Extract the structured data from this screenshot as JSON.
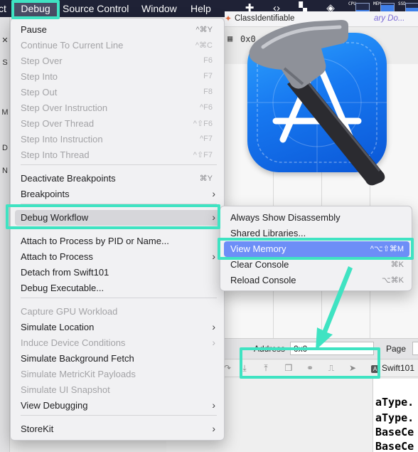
{
  "menubar": {
    "items": [
      {
        "label": "ct"
      },
      {
        "label": "Debug"
      },
      {
        "label": "Source Control"
      },
      {
        "label": "Window"
      },
      {
        "label": "Help"
      }
    ],
    "status_icons": [
      "plus-cross-icon",
      "code-brackets-icon",
      "bookmark-icon",
      "layers-icon"
    ],
    "meters": [
      {
        "label": "CPU",
        "level": 0.35
      },
      {
        "label": "MEM",
        "level": 0.85
      },
      {
        "label": "SSD",
        "level": 0.6
      }
    ]
  },
  "background": {
    "jumpbar_crumb": "ClassIdentifiable",
    "jumpbar_crumb2": "ary Do...",
    "memory_row": "0x0",
    "address_label": "Address",
    "address_value": "0x0",
    "page_label": "Page",
    "debug_target": "Swift101",
    "console_lines": [
      "aType.",
      "aType.",
      "BaseCe",
      "BaseCe"
    ]
  },
  "debug_menu": {
    "items": [
      {
        "label": "Pause",
        "shortcut": "^⌘Y",
        "enabled": true
      },
      {
        "label": "Continue To Current Line",
        "shortcut": "^⌘C",
        "enabled": false
      },
      {
        "label": "Step Over",
        "shortcut": "F6",
        "enabled": false
      },
      {
        "label": "Step Into",
        "shortcut": "F7",
        "enabled": false
      },
      {
        "label": "Step Out",
        "shortcut": "F8",
        "enabled": false
      },
      {
        "label": "Step Over Instruction",
        "shortcut": "^F6",
        "enabled": false
      },
      {
        "label": "Step Over Thread",
        "shortcut": "^⇧F6",
        "enabled": false
      },
      {
        "label": "Step Into Instruction",
        "shortcut": "^F7",
        "enabled": false
      },
      {
        "label": "Step Into Thread",
        "shortcut": "^⇧F7",
        "enabled": false
      },
      {
        "label": "Deactivate Breakpoints",
        "shortcut": "⌘Y",
        "enabled": true
      },
      {
        "label": "Breakpoints",
        "shortcut": "",
        "enabled": true
      },
      {
        "label": "Debug Workflow",
        "shortcut": "",
        "enabled": true
      },
      {
        "label": "Attach to Process by PID or Name...",
        "shortcut": "",
        "enabled": true
      },
      {
        "label": "Attach to Process",
        "shortcut": "",
        "enabled": true
      },
      {
        "label": "Detach from Swift101",
        "shortcut": "",
        "enabled": true
      },
      {
        "label": "Debug Executable...",
        "shortcut": "",
        "enabled": true
      },
      {
        "label": "Capture GPU Workload",
        "shortcut": "",
        "enabled": false
      },
      {
        "label": "Simulate Location",
        "shortcut": "",
        "enabled": true
      },
      {
        "label": "Induce Device Conditions",
        "shortcut": "",
        "enabled": false
      },
      {
        "label": "Simulate Background Fetch",
        "shortcut": "",
        "enabled": true
      },
      {
        "label": "Simulate MetricKit Payloads",
        "shortcut": "",
        "enabled": false
      },
      {
        "label": "Simulate UI Snapshot",
        "shortcut": "",
        "enabled": false
      },
      {
        "label": "View Debugging",
        "shortcut": "",
        "enabled": true
      },
      {
        "label": "StoreKit",
        "shortcut": "",
        "enabled": true
      }
    ]
  },
  "debug_workflow_submenu": {
    "items": [
      {
        "label": "Always Show Disassembly",
        "shortcut": ""
      },
      {
        "label": "Shared Libraries...",
        "shortcut": ""
      },
      {
        "label": "View Memory",
        "shortcut": "^⌥⇧⌘M"
      },
      {
        "label": "Clear Console",
        "shortcut": "⌘K"
      },
      {
        "label": "Reload Console",
        "shortcut": "⌥⌘K"
      }
    ]
  },
  "colors": {
    "menubar_bg": "#1f2236",
    "menu_bg": "#f1f1f3",
    "selection_blue": "#6d8ef7",
    "annotation_teal": "#3fe3c2",
    "xcode_icon_blue": "#1778f0"
  }
}
